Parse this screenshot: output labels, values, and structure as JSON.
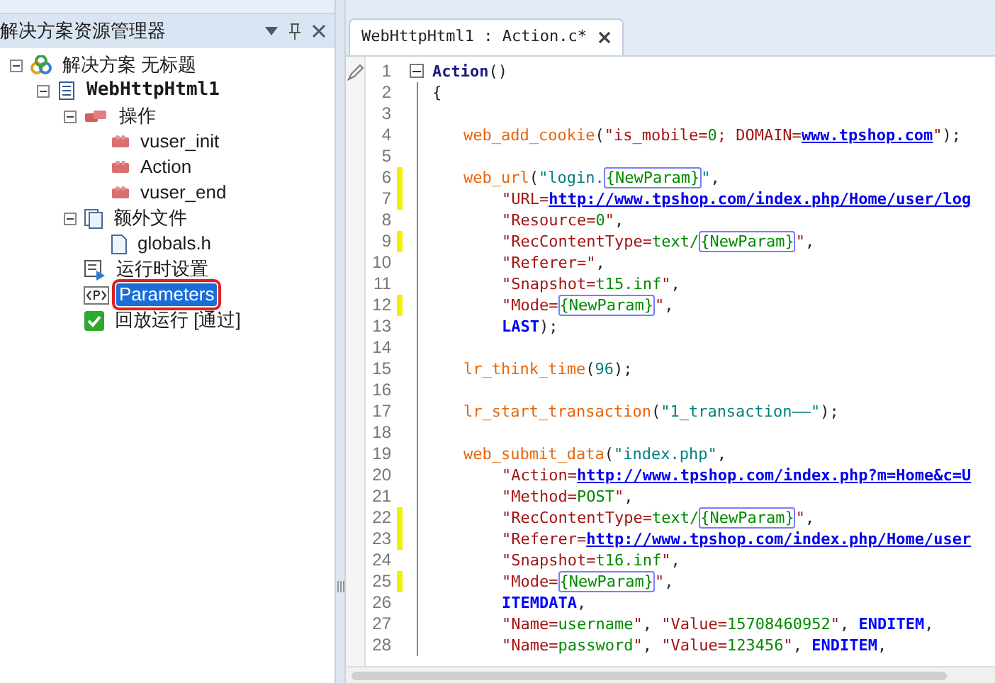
{
  "explorer": {
    "title": "解决方案资源管理器",
    "tree": [
      {
        "label": "解决方案 无标题",
        "kind": "solution",
        "selected": false,
        "circled": false,
        "expanded": true,
        "children": [
          {
            "label": "WebHttpHtml1",
            "kind": "script",
            "selected": false,
            "circled": false,
            "expanded": true,
            "children": [
              {
                "label": "操作",
                "kind": "actions",
                "selected": false,
                "circled": false,
                "expanded": true,
                "children": [
                  {
                    "label": "vuser_init",
                    "kind": "action",
                    "selected": false,
                    "circled": false
                  },
                  {
                    "label": "Action",
                    "kind": "action",
                    "selected": false,
                    "circled": false
                  },
                  {
                    "label": "vuser_end",
                    "kind": "action",
                    "selected": false,
                    "circled": false
                  }
                ]
              },
              {
                "label": "额外文件",
                "kind": "files",
                "selected": false,
                "circled": false,
                "expanded": true,
                "children": [
                  {
                    "label": "globals.h",
                    "kind": "file",
                    "selected": false,
                    "circled": false
                  }
                ]
              },
              {
                "label": "运行时设置",
                "kind": "runtime",
                "selected": false,
                "circled": false
              },
              {
                "label": "Parameters",
                "kind": "params",
                "selected": true,
                "circled": true
              },
              {
                "label": "回放运行 [通过]",
                "kind": "replay",
                "selected": false,
                "circled": false
              }
            ]
          }
        ]
      }
    ]
  },
  "editor": {
    "tabs": [
      {
        "label": "WebHttpHtml1 : Action.c*",
        "selected": true
      }
    ],
    "lines": [
      {
        "no": "1",
        "kind": "top",
        "modified": false,
        "tokens": [
          {
            "kind": "def",
            "text": "Action"
          },
          {
            "kind": "p",
            "text": "()"
          }
        ]
      },
      {
        "no": "2",
        "kind": "top",
        "modified": false,
        "tokens": [
          {
            "kind": "p",
            "text": "{"
          }
        ]
      },
      {
        "no": "3",
        "kind": "top",
        "modified": false
      },
      {
        "no": "4",
        "kind": "body",
        "modified": false,
        "tokens": [
          {
            "kind": "fn",
            "text": "web_add_cookie"
          },
          {
            "kind": "p",
            "text": "("
          },
          {
            "kind": "s",
            "text": "\"is_mobile="
          },
          {
            "kind": "v",
            "text": "0"
          },
          {
            "kind": "s",
            "text": "; DOMAIN="
          },
          {
            "kind": "url",
            "text": "www.tpshop.com"
          },
          {
            "kind": "s",
            "text": "\""
          },
          {
            "kind": "p",
            "text": ");"
          }
        ]
      },
      {
        "no": "5",
        "kind": "top",
        "modified": false
      },
      {
        "no": "6",
        "kind": "body",
        "modified": true,
        "tokens": [
          {
            "kind": "fn",
            "text": "web_url"
          },
          {
            "kind": "p",
            "text": "("
          },
          {
            "kind": "lit",
            "text": "\"login."
          },
          {
            "kind": "param",
            "text": "{NewParam}"
          },
          {
            "kind": "lit",
            "text": "\""
          },
          {
            "kind": "p",
            "text": ","
          }
        ]
      },
      {
        "no": "7",
        "kind": "arg",
        "modified": true,
        "tokens": [
          {
            "kind": "s",
            "text": "\"URL="
          },
          {
            "kind": "url",
            "text": "http://www.tpshop.com/index.php/Home/user/log"
          }
        ]
      },
      {
        "no": "8",
        "kind": "arg",
        "modified": false,
        "tokens": [
          {
            "kind": "s",
            "text": "\"Resource="
          },
          {
            "kind": "v",
            "text": "0"
          },
          {
            "kind": "s",
            "text": "\""
          },
          {
            "kind": "p",
            "text": ","
          }
        ]
      },
      {
        "no": "9",
        "kind": "arg",
        "modified": true,
        "tokens": [
          {
            "kind": "s",
            "text": "\"RecContentType="
          },
          {
            "kind": "v",
            "text": "text/"
          },
          {
            "kind": "param",
            "text": "{NewParam}"
          },
          {
            "kind": "s",
            "text": "\""
          },
          {
            "kind": "p",
            "text": ","
          }
        ]
      },
      {
        "no": "10",
        "kind": "arg",
        "modified": false,
        "tokens": [
          {
            "kind": "s",
            "text": "\"Referer=\""
          },
          {
            "kind": "p",
            "text": ","
          }
        ]
      },
      {
        "no": "11",
        "kind": "arg",
        "modified": false,
        "tokens": [
          {
            "kind": "s",
            "text": "\"Snapshot="
          },
          {
            "kind": "v",
            "text": "t15.inf"
          },
          {
            "kind": "s",
            "text": "\""
          },
          {
            "kind": "p",
            "text": ","
          }
        ]
      },
      {
        "no": "12",
        "kind": "arg",
        "modified": true,
        "tokens": [
          {
            "kind": "s",
            "text": "\"Mode="
          },
          {
            "kind": "param",
            "text": "{NewParam}"
          },
          {
            "kind": "s",
            "text": "\""
          },
          {
            "kind": "p",
            "text": ","
          }
        ]
      },
      {
        "no": "13",
        "kind": "arg",
        "modified": false,
        "tokens": [
          {
            "kind": "kw",
            "text": "LAST"
          },
          {
            "kind": "p",
            "text": ");"
          }
        ]
      },
      {
        "no": "14",
        "kind": "top",
        "modified": false
      },
      {
        "no": "15",
        "kind": "body",
        "modified": false,
        "tokens": [
          {
            "kind": "fn",
            "text": "lr_think_time"
          },
          {
            "kind": "p",
            "text": "("
          },
          {
            "kind": "num",
            "text": "96"
          },
          {
            "kind": "p",
            "text": ");"
          }
        ]
      },
      {
        "no": "16",
        "kind": "top",
        "modified": false
      },
      {
        "no": "17",
        "kind": "body",
        "modified": false,
        "tokens": [
          {
            "kind": "fn",
            "text": "lr_start_transaction"
          },
          {
            "kind": "p",
            "text": "("
          },
          {
            "kind": "lit",
            "text": "\"1_transaction——\""
          },
          {
            "kind": "p",
            "text": ");"
          }
        ]
      },
      {
        "no": "18",
        "kind": "top",
        "modified": false
      },
      {
        "no": "19",
        "kind": "body",
        "modified": false,
        "tokens": [
          {
            "kind": "fn",
            "text": "web_submit_data"
          },
          {
            "kind": "p",
            "text": "("
          },
          {
            "kind": "lit",
            "text": "\"index.php\""
          },
          {
            "kind": "p",
            "text": ","
          }
        ]
      },
      {
        "no": "20",
        "kind": "arg",
        "modified": false,
        "tokens": [
          {
            "kind": "s",
            "text": "\"Action="
          },
          {
            "kind": "url",
            "text": "http://www.tpshop.com/index.php?m=Home&c=U"
          }
        ]
      },
      {
        "no": "21",
        "kind": "arg",
        "modified": false,
        "tokens": [
          {
            "kind": "s",
            "text": "\"Method="
          },
          {
            "kind": "v",
            "text": "POST"
          },
          {
            "kind": "s",
            "text": "\""
          },
          {
            "kind": "p",
            "text": ","
          }
        ]
      },
      {
        "no": "22",
        "kind": "arg",
        "modified": true,
        "tokens": [
          {
            "kind": "s",
            "text": "\"RecContentType="
          },
          {
            "kind": "v",
            "text": "text/"
          },
          {
            "kind": "param",
            "text": "{NewParam}"
          },
          {
            "kind": "s",
            "text": "\""
          },
          {
            "kind": "p",
            "text": ","
          }
        ]
      },
      {
        "no": "23",
        "kind": "arg",
        "modified": true,
        "tokens": [
          {
            "kind": "s",
            "text": "\"Referer="
          },
          {
            "kind": "url",
            "text": "http://www.tpshop.com/index.php/Home/user"
          }
        ]
      },
      {
        "no": "24",
        "kind": "arg",
        "modified": false,
        "tokens": [
          {
            "kind": "s",
            "text": "\"Snapshot="
          },
          {
            "kind": "v",
            "text": "t16.inf"
          },
          {
            "kind": "s",
            "text": "\""
          },
          {
            "kind": "p",
            "text": ","
          }
        ]
      },
      {
        "no": "25",
        "kind": "arg",
        "modified": true,
        "tokens": [
          {
            "kind": "s",
            "text": "\"Mode="
          },
          {
            "kind": "param",
            "text": "{NewParam}"
          },
          {
            "kind": "s",
            "text": "\""
          },
          {
            "kind": "p",
            "text": ","
          }
        ]
      },
      {
        "no": "26",
        "kind": "arg",
        "modified": false,
        "tokens": [
          {
            "kind": "kw",
            "text": "ITEMDATA"
          },
          {
            "kind": "p",
            "text": ","
          }
        ]
      },
      {
        "no": "27",
        "kind": "arg",
        "modified": false,
        "tokens": [
          {
            "kind": "s",
            "text": "\"Name="
          },
          {
            "kind": "v",
            "text": "username"
          },
          {
            "kind": "s",
            "text": "\""
          },
          {
            "kind": "p",
            "text": ", "
          },
          {
            "kind": "s",
            "text": "\"Value="
          },
          {
            "kind": "v",
            "text": "15708460952"
          },
          {
            "kind": "s",
            "text": "\""
          },
          {
            "kind": "p",
            "text": ", "
          },
          {
            "kind": "kw",
            "text": "ENDITEM"
          },
          {
            "kind": "p",
            "text": ","
          }
        ]
      },
      {
        "no": "28",
        "kind": "arg",
        "modified": false,
        "tokens": [
          {
            "kind": "s",
            "text": "\"Name="
          },
          {
            "kind": "v",
            "text": "password"
          },
          {
            "kind": "s",
            "text": "\""
          },
          {
            "kind": "p",
            "text": ", "
          },
          {
            "kind": "s",
            "text": "\"Value="
          },
          {
            "kind": "v",
            "text": "123456"
          },
          {
            "kind": "s",
            "text": "\""
          },
          {
            "kind": "p",
            "text": ", "
          },
          {
            "kind": "kw",
            "text": "ENDITEM"
          },
          {
            "kind": "p",
            "text": ","
          }
        ]
      }
    ]
  }
}
